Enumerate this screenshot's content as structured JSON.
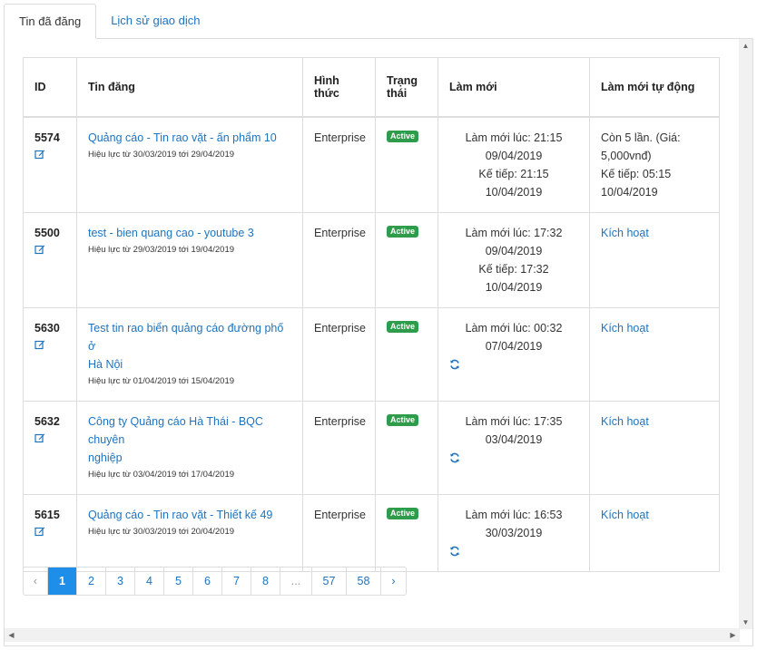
{
  "tabs": [
    {
      "label": "Tin đã đăng",
      "active": true
    },
    {
      "label": "Lịch sử giao dịch",
      "active": false
    }
  ],
  "table": {
    "headers": {
      "id": "ID",
      "title": "Tin đăng",
      "type": "Hình thức",
      "status_line1": "Trạng",
      "status_line2": "thái",
      "refresh": "Làm mới",
      "auto_refresh": "Làm mới tự động"
    },
    "rows": [
      {
        "id": "5574",
        "title": "Quảng cáo - Tin rao vặt - ấn phẩm 10",
        "validity": "Hiệu lực từ 30/03/2019 tới 29/04/2019",
        "type": "Enterprise",
        "status": "Active",
        "refresh_line1": "Làm mới lúc: 21:15",
        "refresh_line2": "09/04/2019",
        "refresh_line3": "Kế tiếp: 21:15 10/04/2019",
        "auto_line1": "Còn 5 lần. (Giá:",
        "auto_line2": "5,000vnđ)",
        "auto_line3": "Kế tiếp: 05:15",
        "auto_line4": "10/04/2019"
      },
      {
        "id": "5500",
        "title": "test - bien quang cao - youtube 3",
        "validity": "Hiệu lực từ 29/03/2019 tới 19/04/2019",
        "type": "Enterprise",
        "status": "Active",
        "refresh_line1": "Làm mới lúc: 17:32",
        "refresh_line2": "09/04/2019",
        "refresh_line3": "Kế tiếp: 17:32 10/04/2019",
        "auto_link": "Kích hoạt"
      },
      {
        "id": "5630",
        "title_line1": "Test tin rao biển quảng cáo đường phố ở",
        "title_line2": "Hà Nội",
        "validity": "Hiệu lực từ 01/04/2019 tới 15/04/2019",
        "type": "Enterprise",
        "status": "Active",
        "refresh_line1": "Làm mới lúc: 00:32",
        "refresh_line2": "07/04/2019",
        "auto_link": "Kích hoạt"
      },
      {
        "id": "5632",
        "title_line1": "Công ty Quảng cáo Hà Thái - BQC chuyên",
        "title_line2": "nghiệp",
        "validity": "Hiệu lực từ 03/04/2019 tới 17/04/2019",
        "type": "Enterprise",
        "status": "Active",
        "refresh_line1": "Làm mới lúc: 17:35",
        "refresh_line2": "03/04/2019",
        "auto_link": "Kích hoạt"
      },
      {
        "id": "5615",
        "title": "Quảng cáo - Tin rao vặt - Thiết kế 49",
        "validity": "Hiệu lực từ 30/03/2019 tới 20/04/2019",
        "type": "Enterprise",
        "status": "Active",
        "refresh_line1": "Làm mới lúc: 16:53",
        "refresh_line2": "30/03/2019",
        "auto_link": "Kích hoạt"
      }
    ]
  },
  "pagination": {
    "prev": "‹",
    "pages": [
      "1",
      "2",
      "3",
      "4",
      "5",
      "6",
      "7",
      "8",
      "...",
      "57",
      "58"
    ],
    "current": "1",
    "next": "›"
  },
  "colors": {
    "link": "#1e73be",
    "active_badge": "#2e9c4a",
    "current_page": "#1e8ee8"
  },
  "icons": {
    "edit": "edit-icon",
    "sync": "sync-icon"
  }
}
